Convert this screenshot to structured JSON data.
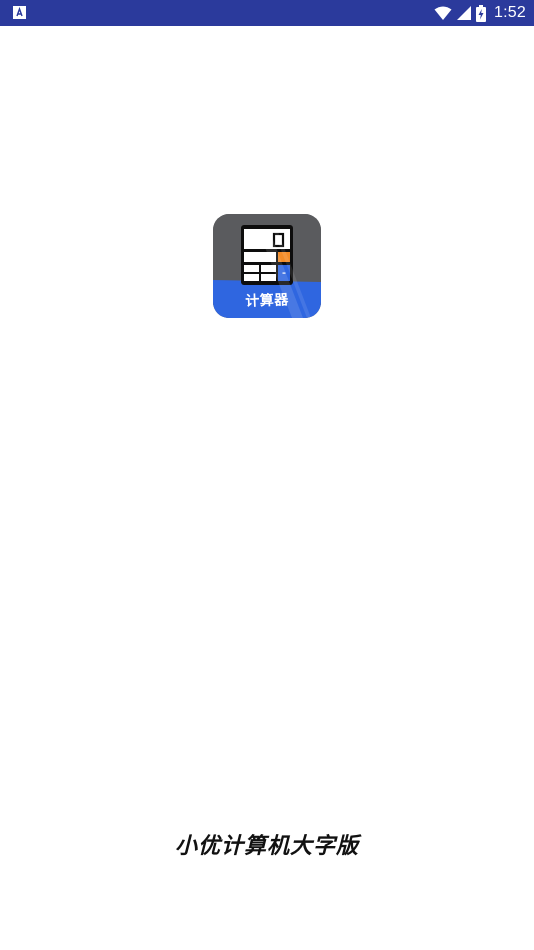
{
  "status_bar": {
    "time": "1:52",
    "background_color": "#2b3a9c",
    "left_icon": "app-notification-icon",
    "icons": [
      "wifi-icon",
      "signal-icon",
      "battery-charging-icon"
    ]
  },
  "splash": {
    "icon_label": "计算器",
    "icon_name": "calculator-icon",
    "app_name": "小优计算机大字版"
  },
  "colors": {
    "icon_top": "#5a5b5e",
    "icon_band": "#2f66e0",
    "accent_orange": "#f28c28",
    "accent_blue": "#2f66e0"
  }
}
